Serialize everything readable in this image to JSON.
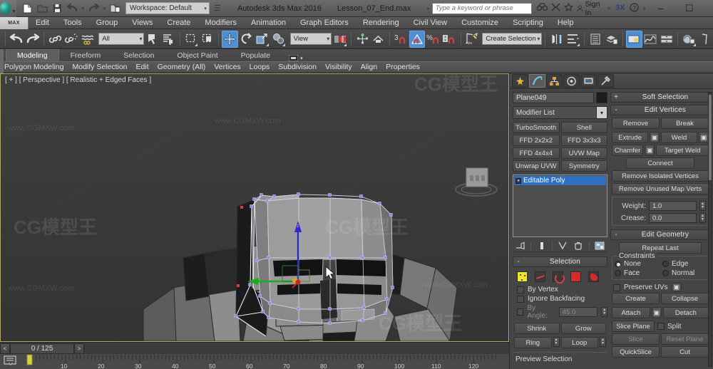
{
  "titlebar": {
    "workspace": "Workspace: Default",
    "app_title": "Autodesk 3ds Max 2016",
    "file_name": "Lesson_07_End.max",
    "search_placeholder": "Type a keyword or phrase",
    "sign_in": "Sign In",
    "quick_access": [
      {
        "name": "new-file-icon",
        "label": "New"
      },
      {
        "name": "open-file-icon",
        "label": "Open"
      },
      {
        "name": "save-file-icon",
        "label": "Save"
      },
      {
        "name": "undo-icon",
        "label": "Undo"
      },
      {
        "name": "redo-icon",
        "label": "Redo"
      },
      {
        "name": "set-project-folder-icon",
        "label": "Set Project Folder"
      }
    ],
    "right_icons": [
      {
        "name": "binoculars-icon",
        "label": "Search"
      },
      {
        "name": "exchange-icon",
        "label": "Autodesk Exchange"
      },
      {
        "name": "star-icon",
        "label": "Favorites"
      },
      {
        "name": "autodesk-360-icon",
        "label": "Autodesk 360"
      },
      {
        "name": "help-icon",
        "label": "Help"
      }
    ],
    "window_buttons": {
      "minimize": "–",
      "maximize": "☐",
      "close": "✕"
    }
  },
  "menubar": {
    "max_button": "MAX",
    "items": [
      "Edit",
      "Tools",
      "Group",
      "Views",
      "Create",
      "Modifiers",
      "Animation",
      "Graph Editors",
      "Rendering",
      "Civil View",
      "Customize",
      "Scripting",
      "Help"
    ]
  },
  "maintoolbar": {
    "selection_filter": "All",
    "reference_coordinate_system": "View",
    "named_selection_sets": "Create Selection Se",
    "buttons": [
      {
        "name": "undo-scene-op-icon",
        "label": "Undo"
      },
      {
        "name": "redo-scene-op-icon",
        "label": "Redo"
      },
      {
        "name": "select-link-icon",
        "label": "Select and Link"
      },
      {
        "name": "unlink-selection-icon",
        "label": "Unlink Selection"
      },
      {
        "name": "bind-space-warp-icon",
        "label": "Bind to Space Warp"
      },
      {
        "name": "select-object-icon",
        "label": "Select Object"
      },
      {
        "name": "select-by-name-icon",
        "label": "Select by Name"
      },
      {
        "name": "rectangular-selection-region-icon",
        "label": "Rectangular Selection Region"
      },
      {
        "name": "window-crossing-icon",
        "label": "Window/Crossing"
      },
      {
        "name": "select-and-move-icon",
        "label": "Select and Move"
      },
      {
        "name": "select-and-rotate-icon",
        "label": "Select and Rotate"
      },
      {
        "name": "select-and-scale-icon",
        "label": "Select and Uniform Scale"
      },
      {
        "name": "select-and-place-icon",
        "label": "Select and Place"
      },
      {
        "name": "use-center-flyout-icon",
        "label": "Use Pivot Point Center"
      },
      {
        "name": "select-and-manipulate-icon",
        "label": "Select and Manipulate"
      },
      {
        "name": "snaps-toggle-icon",
        "label": "3D Snaps Toggle"
      },
      {
        "name": "angle-snap-toggle-icon",
        "label": "Angle Snap Toggle"
      },
      {
        "name": "percent-snap-toggle-icon",
        "label": "Percent Snap Toggle"
      },
      {
        "name": "spinner-snap-toggle-icon",
        "label": "Spinner Snap Toggle"
      },
      {
        "name": "edit-named-selection-sets-icon",
        "label": "Edit Named Selection Sets"
      },
      {
        "name": "mirror-icon",
        "label": "Mirror"
      },
      {
        "name": "align-icon",
        "label": "Align"
      },
      {
        "name": "layer-manager-icon",
        "label": "Layer Explorer"
      },
      {
        "name": "toggle-scene-explorer-icon",
        "label": "Toggle Scene Explorer"
      },
      {
        "name": "render-setup-icon",
        "label": "Render Setup"
      },
      {
        "name": "curve-editor-icon",
        "label": "Curve Editor"
      },
      {
        "name": "schematic-view-icon",
        "label": "Schematic View"
      },
      {
        "name": "material-editor-icon",
        "label": "Material Editor"
      },
      {
        "name": "render-production-icon",
        "label": "Render Production"
      }
    ],
    "snap_label": "3",
    "percent_label": "%",
    "named_set_label": "Abc"
  },
  "ribbon": {
    "tabs": [
      {
        "label": "Modeling",
        "active": true
      },
      {
        "label": "Freeform",
        "active": false
      },
      {
        "label": "Selection",
        "active": false
      },
      {
        "label": "Object Paint",
        "active": false
      },
      {
        "label": "Populate",
        "active": false
      }
    ],
    "panel_icon": "ribbon-display-icon",
    "subtabs": [
      "Polygon Modeling",
      "Modify Selection",
      "Edit",
      "Geometry (All)",
      "Vertices",
      "Loops",
      "Subdivision",
      "Visibility",
      "Align",
      "Properties"
    ]
  },
  "viewport": {
    "label": "[ + ] [ Perspective ] [ Realistic + Edged Faces ]",
    "gizmo_axis_z": "z",
    "cursor": "arrow-cursor",
    "viewcube": "viewcube-icon",
    "watermarks": [
      "www.CGMXW.com",
      "www.CGMXW.com",
      "www.CGMXW.com",
      "www.CGMXW.com",
      "CG模型王",
      "CG模型王",
      "CG模型王",
      "CG模型王"
    ]
  },
  "timeline": {
    "prev_label": "<",
    "next_label": ">",
    "frame_display": "0 / 125",
    "key_mode_icon": "key-mode-icon",
    "ticks": [
      "10",
      "20",
      "30",
      "40",
      "50",
      "60",
      "70",
      "80",
      "90",
      "100",
      "110",
      "120"
    ]
  },
  "command_panel": {
    "tabs": [
      {
        "name": "create-tab",
        "icon": "star-burst-icon",
        "selected": false
      },
      {
        "name": "modify-tab",
        "icon": "bent-arrow-icon",
        "selected": true
      },
      {
        "name": "hierarchy-tab",
        "icon": "hierarchy-icon",
        "selected": false
      },
      {
        "name": "motion-tab",
        "icon": "wheel-icon",
        "selected": false
      },
      {
        "name": "display-tab",
        "icon": "monitor-icon",
        "selected": false
      },
      {
        "name": "utilities-tab",
        "icon": "hammer-icon",
        "selected": false
      }
    ],
    "object_name": "Plane049",
    "object_color": "#1c1c1c",
    "modifier_list_label": "Modifier List",
    "modifier_buttons": [
      "TurboSmooth",
      "Shell",
      "FFD 2x2x2",
      "FFD 3x3x3",
      "FFD 4x4x4",
      "UVW Map",
      "Unwrap UVW",
      "Symmetry"
    ],
    "stack": [
      {
        "label": "Editable Poly",
        "selected": true
      }
    ],
    "stack_icons": [
      {
        "name": "pin-stack-icon",
        "label": "Pin Stack"
      },
      {
        "name": "show-end-result-icon",
        "label": "Show end result"
      },
      {
        "name": "make-unique-icon",
        "label": "Make unique"
      },
      {
        "name": "remove-modifier-icon",
        "label": "Remove modifier from the stack"
      },
      {
        "name": "configure-modifier-sets-icon",
        "label": "Configure Modifier Sets"
      }
    ],
    "selection_rollup": {
      "title": "Selection",
      "sub_objects": [
        {
          "name": "vertex-subobject",
          "label": "Vertex",
          "active": true
        },
        {
          "name": "edge-subobject",
          "label": "Edge",
          "active": false
        },
        {
          "name": "border-subobject",
          "label": "Border",
          "active": false
        },
        {
          "name": "polygon-subobject",
          "label": "Polygon",
          "active": false
        },
        {
          "name": "element-subobject",
          "label": "Element",
          "active": false
        }
      ],
      "by_vertex": "By Vertex",
      "ignore_backfacing": "Ignore Backfacing",
      "by_angle": "By Angle:",
      "by_angle_value": "45.0",
      "shrink": "Shrink",
      "grow": "Grow",
      "ring": "Ring",
      "loop": "Loop",
      "preview_selection": "Preview Selection"
    },
    "soft_selection_rollup": {
      "title": "Soft Selection",
      "expander": "+"
    },
    "edit_vertices_rollup": {
      "title": "Edit Vertices",
      "expander": "-",
      "remove": "Remove",
      "break": "Break",
      "extrude": "Extrude",
      "weld": "Weld",
      "chamfer": "Chamfer",
      "target_weld": "Target Weld",
      "connect": "Connect",
      "remove_isolated": "Remove Isolated Vertices",
      "remove_unused": "Remove Unused Map Verts",
      "weight_label": "Weight:",
      "weight_value": "1.0",
      "crease_label": "Crease:",
      "crease_value": "0.0"
    },
    "edit_geometry_rollup": {
      "title": "Edit Geometry",
      "expander": "-",
      "repeat_last": "Repeat Last",
      "constraints_label": "Constraints",
      "constraints": [
        {
          "label": "None",
          "selected": true
        },
        {
          "label": "Edge",
          "selected": false
        },
        {
          "label": "Face",
          "selected": false
        },
        {
          "label": "Normal",
          "selected": false
        }
      ],
      "preserve_uvs": "Preserve UVs",
      "create": "Create",
      "collapse": "Collapse",
      "attach": "Attach",
      "detach": "Detach",
      "slice_plane": "Slice Plane",
      "split": "Split",
      "slice": "Slice",
      "reset_plane": "Reset Plane",
      "quickslice": "QuickSlice",
      "cut": "Cut"
    }
  }
}
